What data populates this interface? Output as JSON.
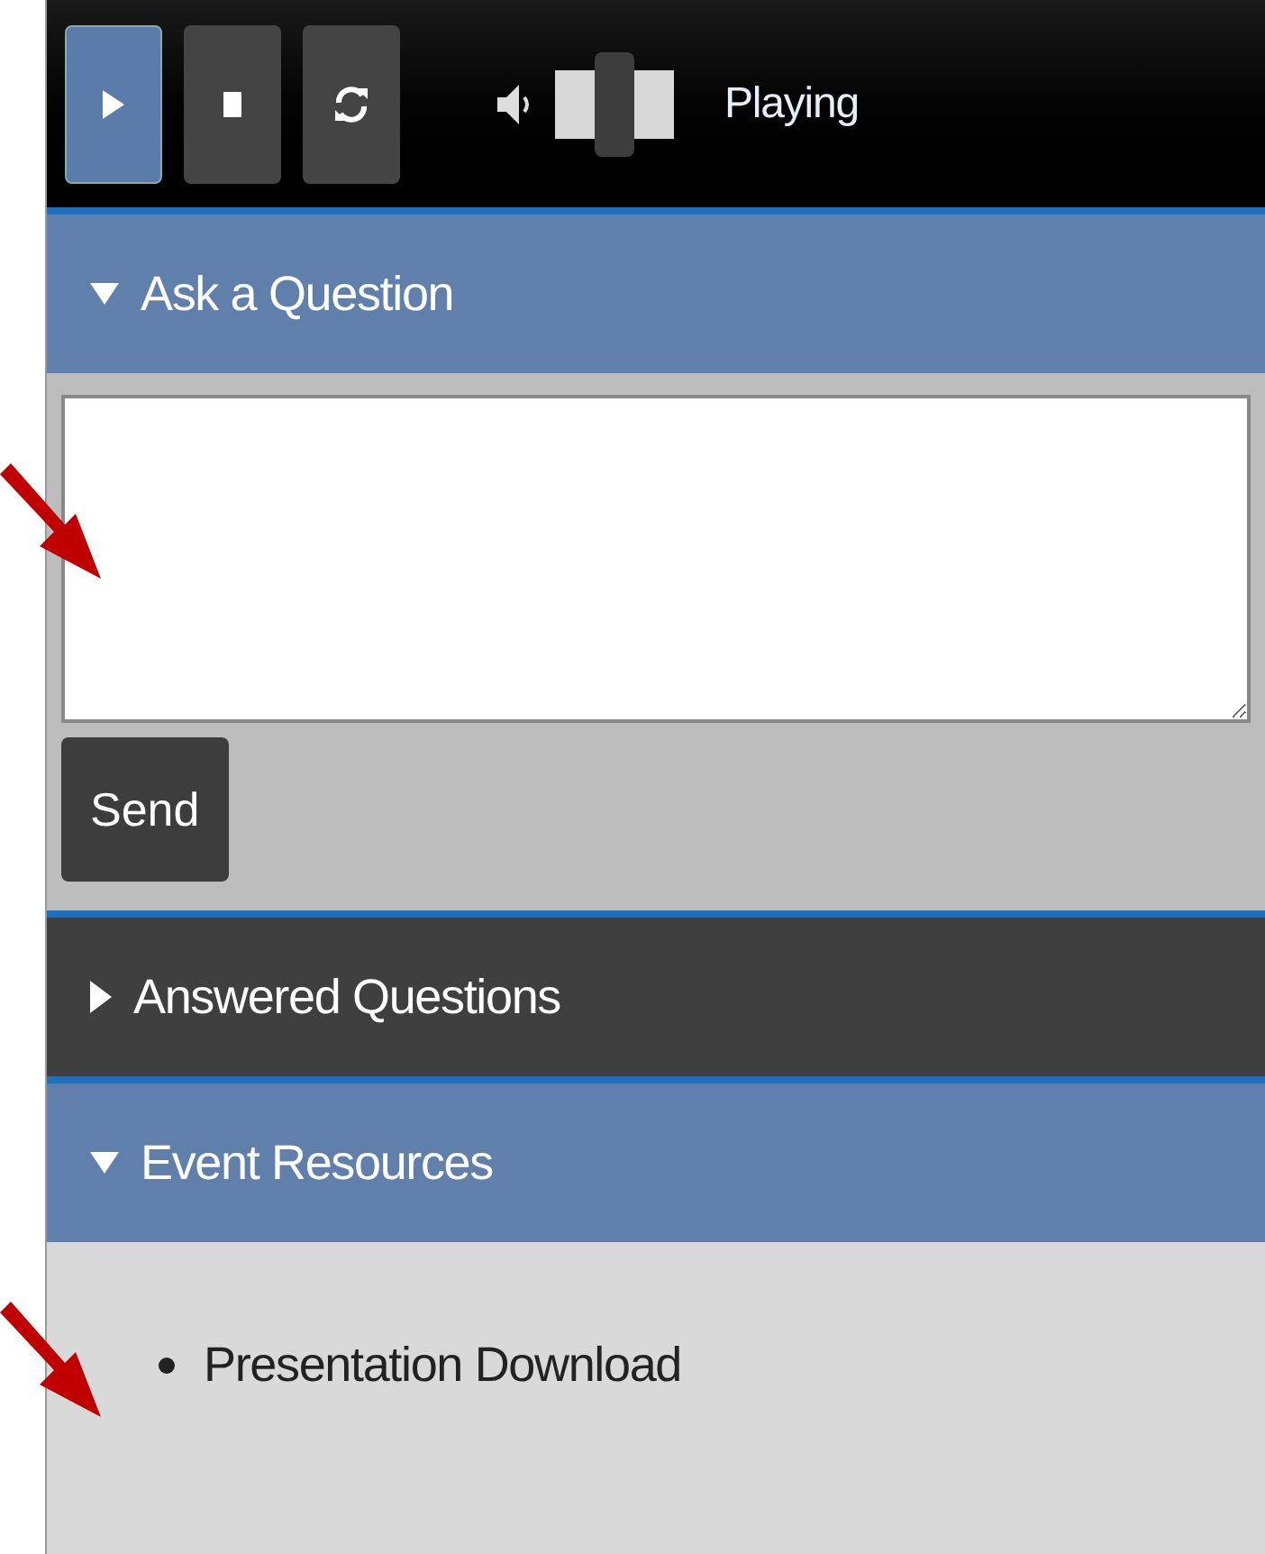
{
  "player": {
    "buttons": [
      {
        "kind": "play",
        "selected": true
      },
      {
        "kind": "stop",
        "selected": false
      },
      {
        "kind": "refresh",
        "selected": false
      }
    ],
    "volume": {
      "level": 0.5
    },
    "status": "Playing"
  },
  "sections": [
    {
      "kind": "question",
      "title": "Ask a Question",
      "expanded": true,
      "send_label": "Send"
    },
    {
      "kind": "answered",
      "title": "Answered Questions",
      "expanded": false
    },
    {
      "kind": "resources",
      "title": "Event Resources",
      "expanded": true,
      "items": [
        "Presentation Download"
      ]
    }
  ]
}
